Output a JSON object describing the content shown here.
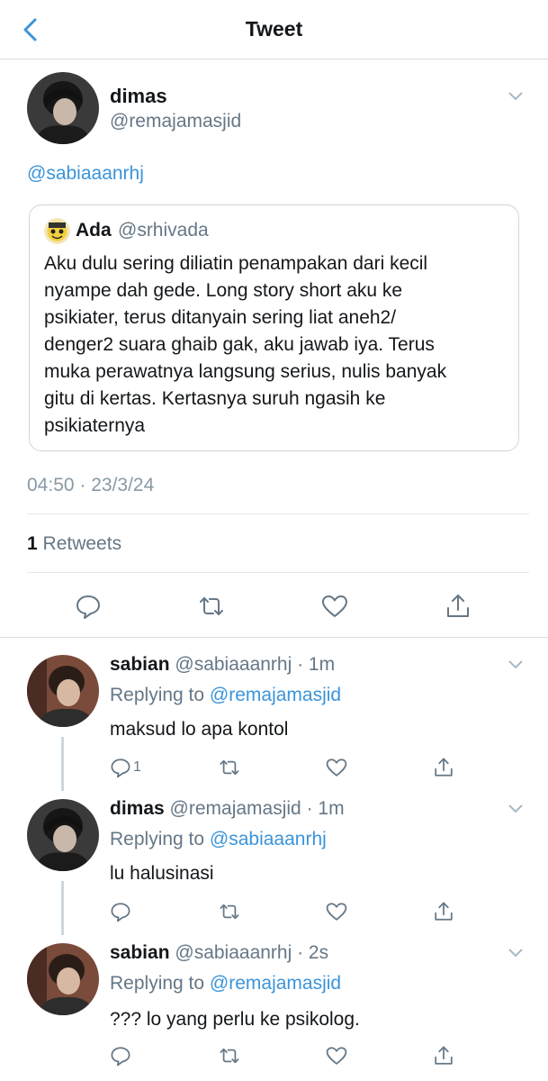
{
  "nav": {
    "title": "Tweet",
    "back_icon": "chevron-left-icon"
  },
  "main_tweet": {
    "name": "dimas",
    "handle": "@remajamasjid",
    "mention": "@sabiaaanrhj",
    "quote": {
      "name": "Ada",
      "handle": "@srhivada",
      "lines": [
        "Aku dulu sering diliatin penampakan dari kecil",
        "nyampe dah gede. Long story short aku ke",
        "psikiater, terus ditanyain sering liat aneh2/",
        "denger2 suara ghaib gak, aku jawab iya. Terus",
        "muka perawatnya langsung serius, nulis banyak",
        "gitu di kertas. Kertasnya suruh ngasih ke",
        "psikiaternya"
      ]
    },
    "timestamp": "04:50 · 23/3/24",
    "retweet_count": "1",
    "retweet_label": "Retweets"
  },
  "replies": [
    {
      "name": "sabian",
      "meta": "@sabiaaanrhj · 1m",
      "replying_label": "Replying to",
      "replying_to": "@remajamasjid",
      "text": "maksud lo apa kontol",
      "reply_count": "1"
    },
    {
      "name": "dimas",
      "meta": "@remajamasjid · 1m",
      "replying_label": "Replying to",
      "replying_to": "@sabiaaanrhj",
      "text": "lu halusinasi",
      "reply_count": ""
    },
    {
      "name": "sabian",
      "meta": "@sabiaaanrhj · 2s",
      "replying_label": "Replying to",
      "replying_to": "@remajamasjid",
      "text": "??? lo yang perlu ke psikolog.",
      "reply_count": ""
    }
  ],
  "colors": {
    "link": "#3b94d9",
    "muted": "#657786",
    "icon": "#657786"
  }
}
